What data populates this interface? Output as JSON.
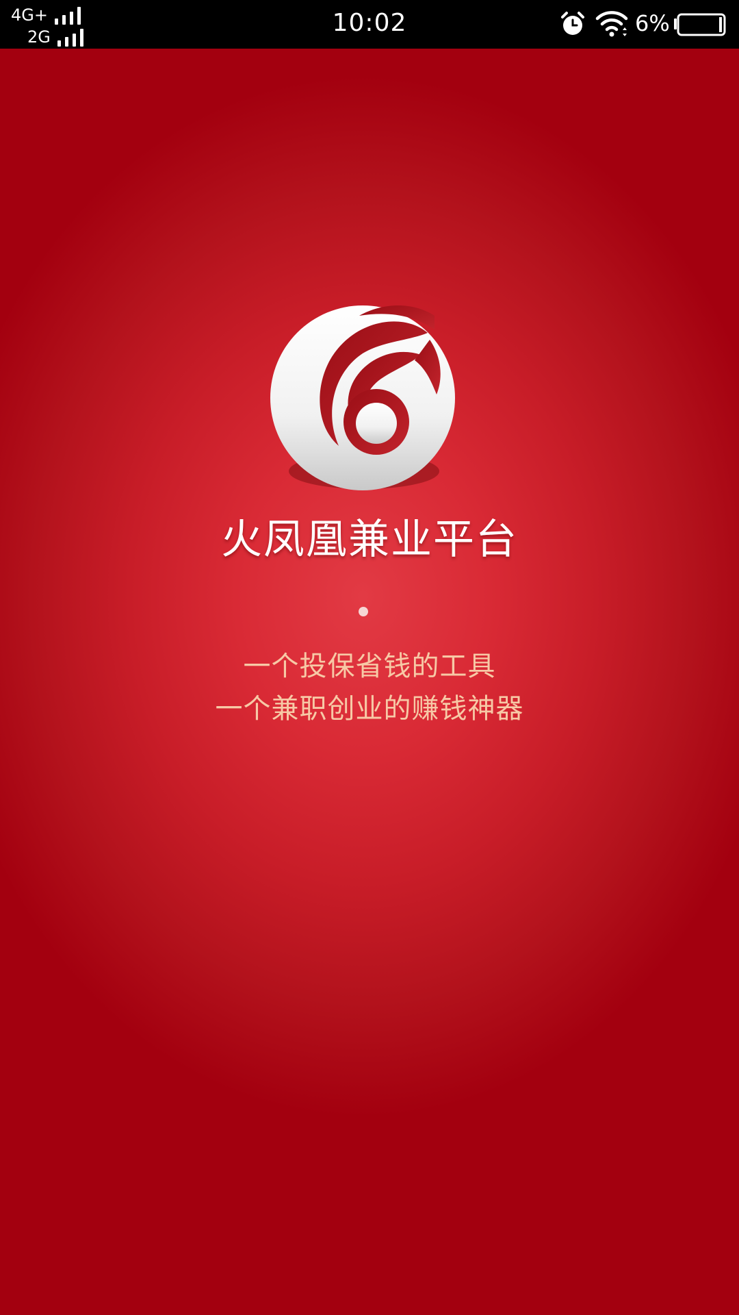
{
  "status_bar": {
    "network_1": "4G+",
    "network_2": "2G",
    "time": "10:02",
    "battery_percent": "6%",
    "icons": [
      "signal-icon",
      "alarm-icon",
      "wifi-icon",
      "battery-icon"
    ]
  },
  "splash": {
    "app_title": "火凤凰兼业平台",
    "slogan_line_1": "一个投保省钱的工具",
    "slogan_line_2": "一个兼职创业的赚钱神器",
    "logo_icon": "phoenix-logo-icon"
  },
  "colors": {
    "background_center": "#e23a44",
    "background_edge": "#a3000f",
    "slogan_text": "#f7c9a6",
    "title_text": "#ffffff",
    "status_bar": "#000000"
  }
}
